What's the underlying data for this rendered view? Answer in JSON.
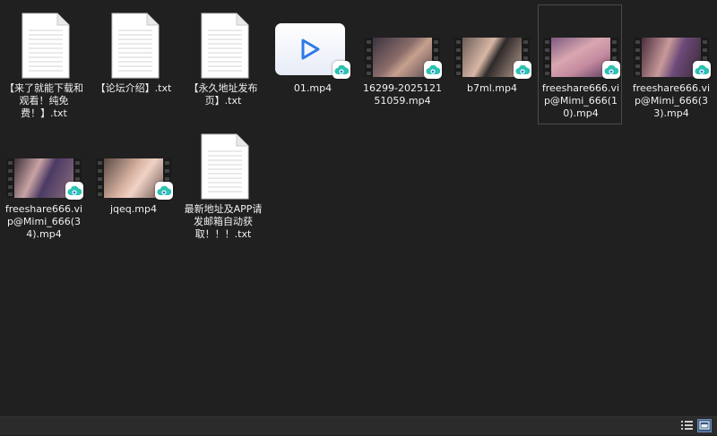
{
  "files": [
    {
      "name": "【来了就能下载和观看！纯免费！】.txt",
      "type": "txt"
    },
    {
      "name": "【论坛介绍】.txt",
      "type": "txt"
    },
    {
      "name": "【永久地址发布页】.txt",
      "type": "txt"
    },
    {
      "name": "01.mp4",
      "type": "mp4-generic"
    },
    {
      "name": "16299-202512151059.mp4",
      "type": "mp4-thumb"
    },
    {
      "name": "b7ml.mp4",
      "type": "mp4-thumb"
    },
    {
      "name": "freeshare666.vip@Mimi_666(10).mp4",
      "type": "mp4-thumb",
      "selected": true
    },
    {
      "name": "freeshare666.vip@Mimi_666(33).mp4",
      "type": "mp4-thumb"
    },
    {
      "name": "freeshare666.vip@Mimi_666(34).mp4",
      "type": "mp4-thumb"
    },
    {
      "name": "jqeq.mp4",
      "type": "mp4-thumb"
    },
    {
      "name": "最新地址及APP请发邮箱自动获取！！！.txt",
      "type": "txt"
    }
  ],
  "icons": {
    "sync_badge": "cloud-sync-icon",
    "text_file": "text-document-icon",
    "video_file": "video-file-icon"
  },
  "colors": {
    "background": "#202020",
    "text": "#f0f0f0",
    "accent_blue": "#2f7ae5",
    "cloud_teal": "#2bc3b1"
  },
  "statusbar": {
    "views": [
      "details-view-icon",
      "large-icons-view-icon"
    ]
  }
}
